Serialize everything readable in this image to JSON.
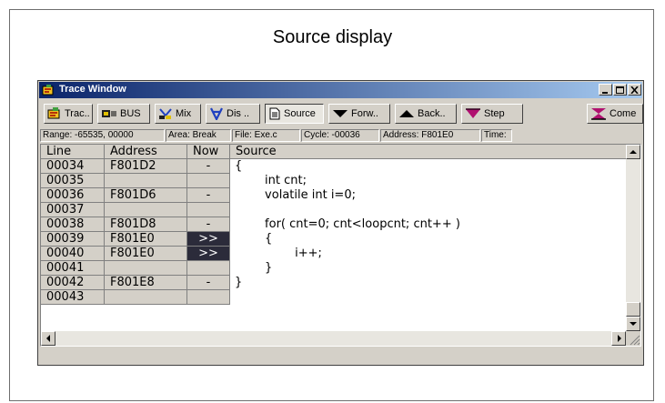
{
  "caption": "Source display",
  "window": {
    "title": "Trace Window"
  },
  "toolbar": [
    {
      "id": "trace",
      "label": "Trac..",
      "icon": "trace-icon"
    },
    {
      "id": "bus",
      "label": "BUS",
      "icon": "bus-icon"
    },
    {
      "id": "mix",
      "label": "Mix",
      "icon": "mix-icon"
    },
    {
      "id": "dis",
      "label": "Dis ..",
      "icon": "disassemble-icon"
    },
    {
      "id": "source",
      "label": "Source",
      "icon": "document-icon",
      "pressed": true
    },
    {
      "id": "forward",
      "label": "Forw..",
      "icon": "triangle-down-icon"
    },
    {
      "id": "back",
      "label": "Back..",
      "icon": "triangle-up-icon"
    },
    {
      "id": "step",
      "label": "Step",
      "icon": "step-icon"
    },
    {
      "id": "come",
      "label": "Come",
      "icon": "come-icon"
    }
  ],
  "status": {
    "range": "Range: -65535, 00000",
    "area": "Area: Break",
    "file": "File: Exe.c",
    "cycle": "Cycle: -00036",
    "address": "Address: F801E0",
    "time": "Time:"
  },
  "columns": {
    "line": "Line",
    "address": "Address",
    "now": "Now",
    "source": "Source"
  },
  "rows": [
    {
      "line": "00034",
      "address": "F801D2",
      "now": "-",
      "source": "{"
    },
    {
      "line": "00035",
      "address": "",
      "now": "",
      "source": "        int cnt;"
    },
    {
      "line": "00036",
      "address": "F801D6",
      "now": "-",
      "source": "        volatile int i=0;"
    },
    {
      "line": "00037",
      "address": "",
      "now": "",
      "source": ""
    },
    {
      "line": "00038",
      "address": "F801D8",
      "now": "-",
      "source": "        for( cnt=0; cnt<loopcnt; cnt++ )"
    },
    {
      "line": "00039",
      "address": "F801E0",
      "now": ">>",
      "source": "        {"
    },
    {
      "line": "00040",
      "address": "F801E0",
      "now": ">>",
      "source": "                i++;"
    },
    {
      "line": "00041",
      "address": "",
      "now": "",
      "source": "        }"
    },
    {
      "line": "00042",
      "address": "F801E8",
      "now": "-",
      "source": "}"
    },
    {
      "line": "00043",
      "address": "",
      "now": "",
      "source": ""
    }
  ],
  "colors": {
    "title_start": "#0a246a",
    "title_end": "#a6caf0",
    "active_now": "#2b2b3a",
    "face": "#d4d0c8"
  }
}
